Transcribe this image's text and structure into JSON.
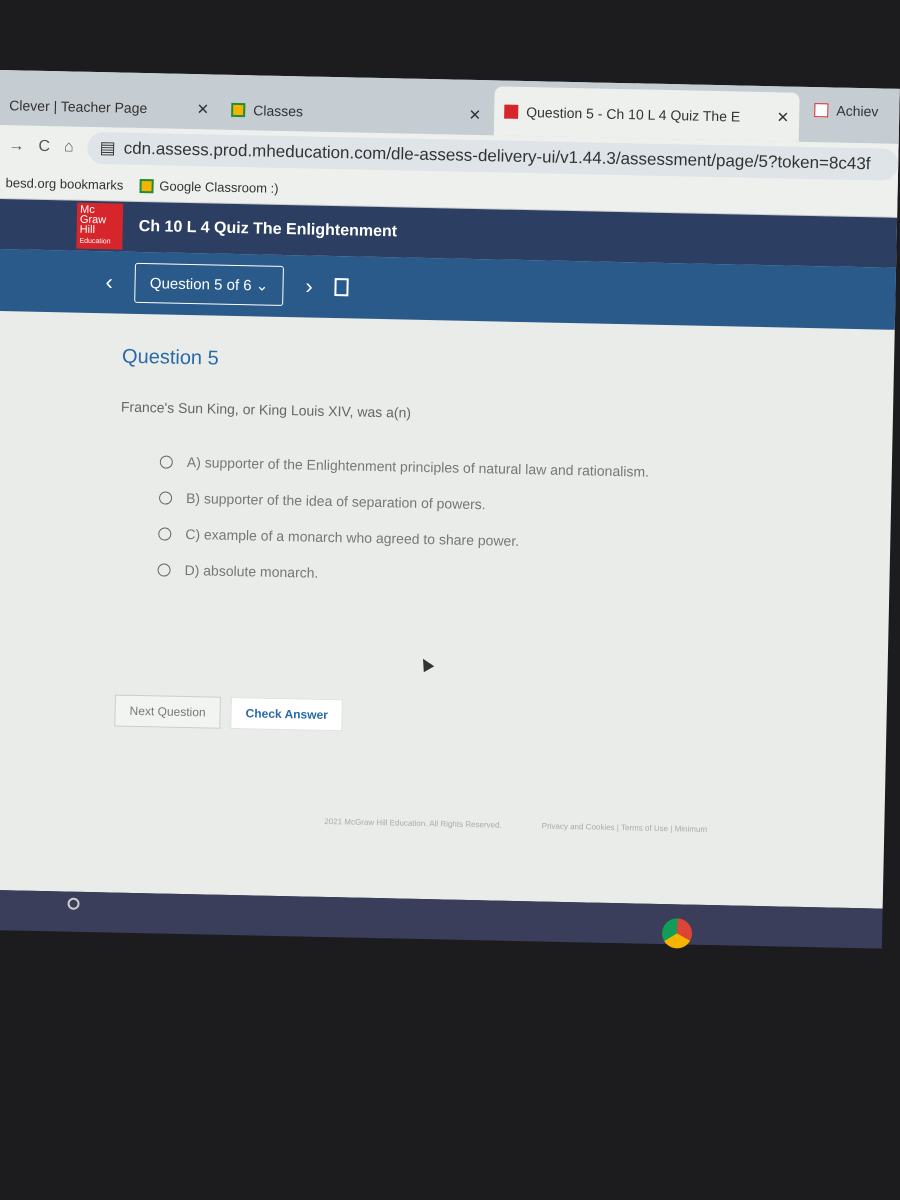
{
  "browser": {
    "tabs": [
      {
        "label": "Clever | Teacher Page"
      },
      {
        "label": "Classes"
      },
      {
        "label": "Question 5 - Ch 10 L 4 Quiz The E"
      },
      {
        "label": "Achiev"
      }
    ],
    "url": "cdn.assess.prod.mheducation.com/dle-assess-delivery-ui/v1.44.3/assessment/page/5?token=8c43f",
    "bookmarks": [
      {
        "label": "besd.org bookmarks"
      },
      {
        "label": "Google Classroom :)"
      }
    ]
  },
  "header": {
    "logo": "Mc Graw Hill Education",
    "title": "Ch 10 L 4 Quiz The Enlightenment"
  },
  "nav": {
    "question_selector": "Question 5 of 6"
  },
  "question": {
    "heading": "Question 5",
    "prompt": "France's Sun King, or King Louis XIV, was a(n)",
    "options": [
      "A) supporter of the Enlightenment principles of natural law and rationalism.",
      "B) supporter of the idea of separation of powers.",
      "C) example of a monarch who agreed to share power.",
      "D) absolute monarch."
    ]
  },
  "buttons": {
    "next": "Next Question",
    "check": "Check Answer"
  },
  "footer": {
    "copyright": "2021 McGraw Hill Education. All Rights Reserved.",
    "links": "Privacy and Cookies | Terms of Use | Minimum"
  }
}
